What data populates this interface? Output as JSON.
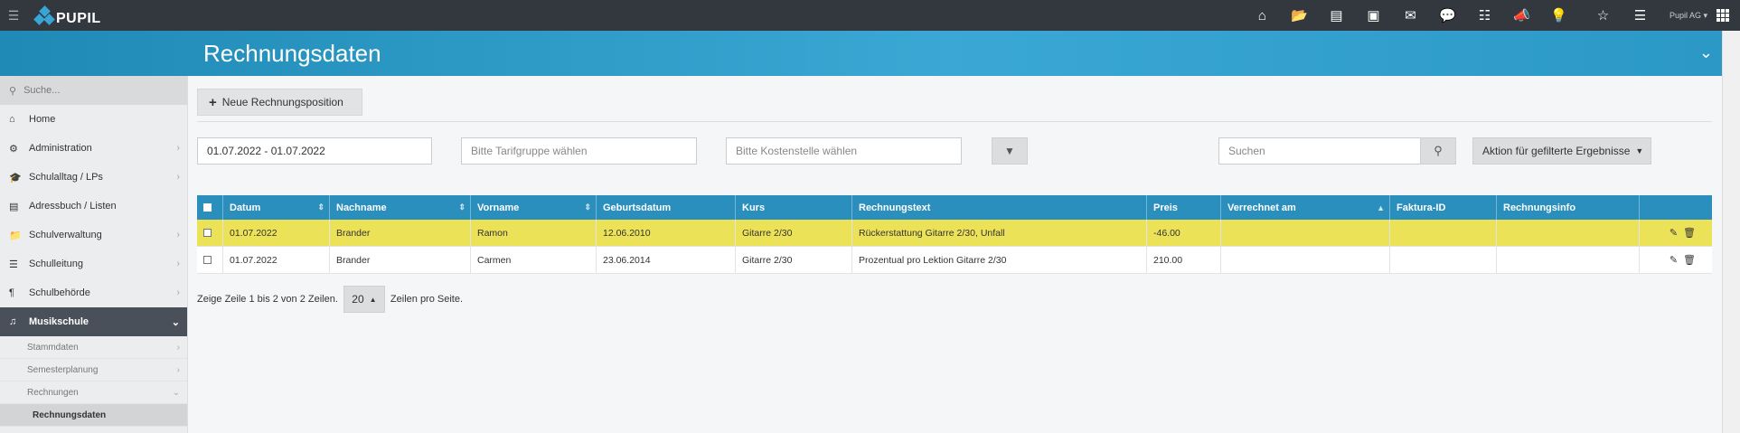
{
  "app": {
    "logo_text": "PUPIL",
    "user_label": "Pupil AG"
  },
  "header": {
    "title": "Rechnungsdaten"
  },
  "sidebar": {
    "search_placeholder": "Suche...",
    "items": [
      {
        "label": "Home",
        "icon": "home-icon"
      },
      {
        "label": "Administration",
        "icon": "cogs-icon"
      },
      {
        "label": "Schulalltag / LPs",
        "icon": "graduation-cap-icon"
      },
      {
        "label": "Adressbuch / Listen",
        "icon": "address-card-icon"
      },
      {
        "label": "Schulverwaltung",
        "icon": "folder-icon"
      },
      {
        "label": "Schulleitung",
        "icon": "signpost-icon"
      },
      {
        "label": "Schulbehörde",
        "icon": "paragraph-icon"
      },
      {
        "label": "Musikschule",
        "icon": "music-icon"
      }
    ],
    "subitems": [
      {
        "label": "Stammdaten"
      },
      {
        "label": "Semesterplanung"
      },
      {
        "label": "Rechnungen"
      },
      {
        "label": "Rechnungsdaten"
      }
    ]
  },
  "toolbar": {
    "new_button": "Neue Rechnungsposition",
    "date_range": "01.07.2022 - 01.07.2022",
    "tarif_placeholder": "Bitte Tarifgruppe wählen",
    "kosten_placeholder": "Bitte Kostenstelle wählen",
    "search_placeholder": "Suchen",
    "action_button": "Aktion für gefilterte Ergebnisse"
  },
  "table": {
    "columns": [
      "Datum",
      "Nachname",
      "Vorname",
      "Geburtsdatum",
      "Kurs",
      "Rechnungstext",
      "Preis",
      "Verrechnet am",
      "Faktura-ID",
      "Rechnungsinfo"
    ],
    "rows": [
      {
        "datum": "01.07.2022",
        "nachname": "Brander",
        "vorname": "Ramon",
        "geburtsdatum": "12.06.2010",
        "kurs": "Gitarre 2/30",
        "text": "Rückerstattung Gitarre 2/30, Unfall",
        "preis": "-46.00",
        "verrechnet": "",
        "faktura": "",
        "info": ""
      },
      {
        "datum": "01.07.2022",
        "nachname": "Brander",
        "vorname": "Carmen",
        "geburtsdatum": "23.06.2014",
        "kurs": "Gitarre 2/30",
        "text": "Prozentual pro Lektion Gitarre 2/30",
        "preis": "210.00",
        "verrechnet": "",
        "faktura": "",
        "info": ""
      }
    ]
  },
  "pager": {
    "summary": "Zeige Zeile 1 bis 2 von 2 Zeilen.",
    "page_size": "20",
    "suffix": "Zeilen pro Seite."
  },
  "colors": {
    "topbar": "#33383f",
    "header_blue": "#3aa7d4",
    "table_head": "#2b8fbd",
    "highlight": "#ece258",
    "sidebar_active": "#4a5059"
  }
}
